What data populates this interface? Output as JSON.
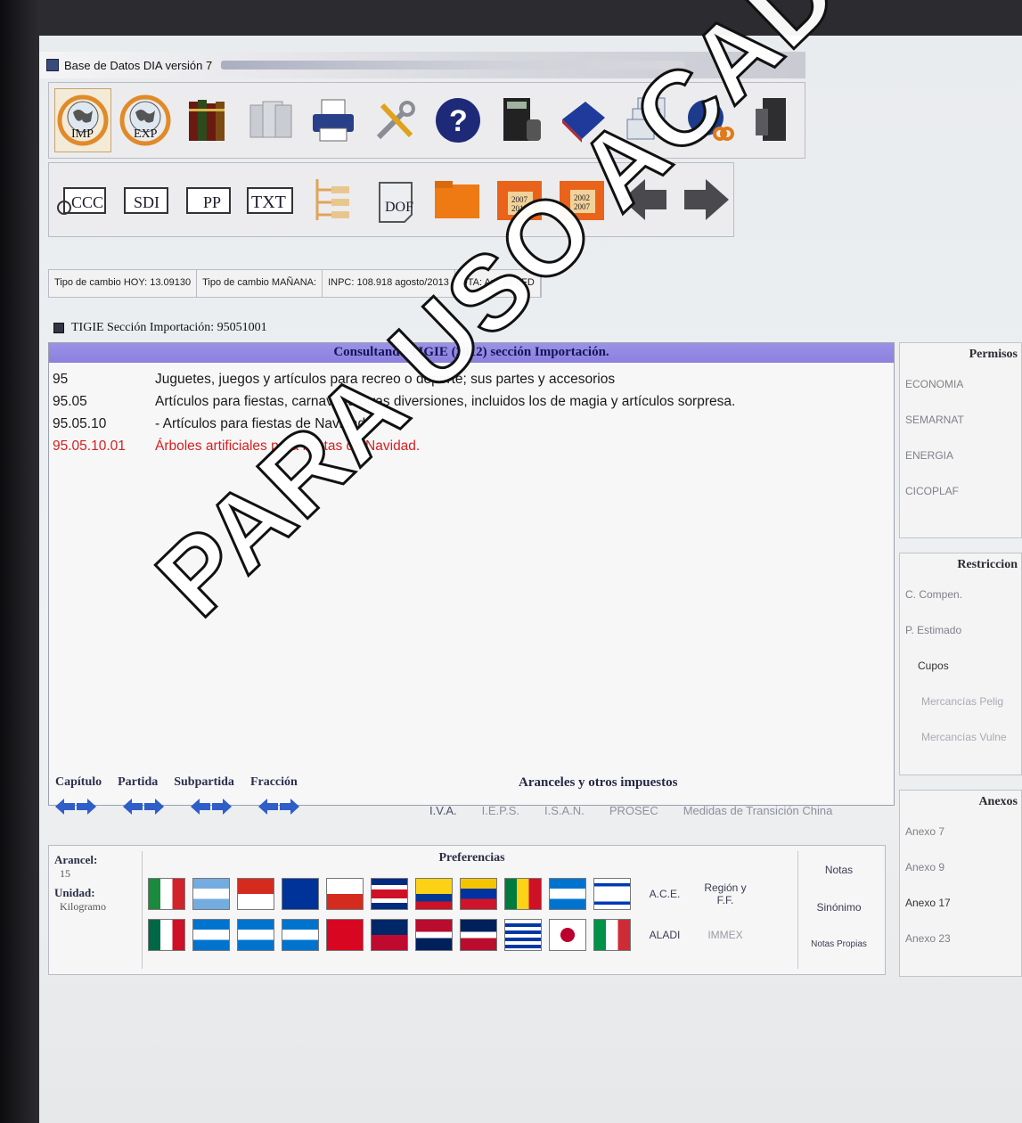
{
  "window": {
    "title": "Base de Datos DIA versión 7"
  },
  "toolbar_row1": {
    "imp_label": "IMP",
    "exp_label": "EXP",
    "icons": [
      "import-globe-icon",
      "export-globe-icon",
      "books-icon",
      "documents-icon",
      "printer-icon",
      "tools-icon",
      "help-icon",
      "calculator-icon",
      "book-icon",
      "windows-icon",
      "globe-link-icon",
      "exit-door-icon"
    ]
  },
  "toolbar_row2": {
    "ccc_label": "CCC",
    "sdi_label": "SDI",
    "pp_label": "PP",
    "txt_label": "TXT",
    "dof_label": "DOF",
    "folder_2007_2012_label": "2007\n2012",
    "folder_2002_2007_label": "2002\n2007",
    "icons": [
      "tree-icon",
      "folder-icon",
      "back-arrow-icon",
      "forward-arrow-icon"
    ]
  },
  "status": {
    "tipo_cambio_hoy": "Tipo de cambio HOY: 13.09130",
    "tipo_cambio_manana": "Tipo de cambio MAÑANA:",
    "inpc": "INPC: 108.918 agosto/2013",
    "dta": "DTA: Art. 49 LFD"
  },
  "tigie_window": {
    "title": "TIGIE Sección Importación: 95051001",
    "header": "Consultando TIGIE (2012) sección Importación.",
    "rows": [
      {
        "code": "95",
        "desc": "Juguetes, juegos y artículos para recreo o deporte; sus partes y accesorios"
      },
      {
        "code": "95.05",
        "desc": "Artículos para fiestas, carnaval u otras diversiones, incluidos los de magia y artículos sorpresa."
      },
      {
        "code": "95.05.10",
        "desc": "- Artículos para fiestas de Navidad."
      },
      {
        "code": "95.05.10.01",
        "desc": "Árboles artificiales para fiestas de Navidad."
      }
    ]
  },
  "permisos": {
    "header": "Permisos",
    "items": [
      "ECONOMIA",
      "SEMARNAT",
      "ENERGIA",
      "CICOPLAF"
    ]
  },
  "restricciones": {
    "header": "Restriccion",
    "items": [
      "C. Compen.",
      "P. Estimado",
      "Cupos",
      "Mercancías Pelig",
      "Mercancías Vulne"
    ]
  },
  "anexos": {
    "header": "Anexos",
    "items": [
      "Anexo 7",
      "Anexo 9",
      "Anexo 17",
      "Anexo 23"
    ]
  },
  "navigation": {
    "labels": [
      "Capítulo",
      "Partida",
      "Subpartida",
      "Fracción"
    ],
    "aranceles_title": "Aranceles y otros impuestos",
    "taxes": [
      "I.V.A.",
      "I.E.P.S.",
      "I.S.A.N.",
      "PROSEC",
      "Medidas de Transición China"
    ]
  },
  "bottom": {
    "arancel_label": "Arancel:",
    "arancel_value": "15",
    "unidad_label": "Unidad:",
    "unidad_value": "Kilogramo",
    "preferencias_title": "Preferencias",
    "ace": "A.C.E.",
    "region": "Región y F.F.",
    "aladi": "ALADI",
    "immex": "IMMEX",
    "notas": "Notas",
    "sinonimo": "Sinónimo",
    "notas_propias": "Notas Propias"
  },
  "watermark": "PARA USO ACADEMICO",
  "colors": {
    "header_purple": "#8c80de",
    "highlight_red": "#d62020",
    "arrow_blue": "#2f5ec9"
  }
}
